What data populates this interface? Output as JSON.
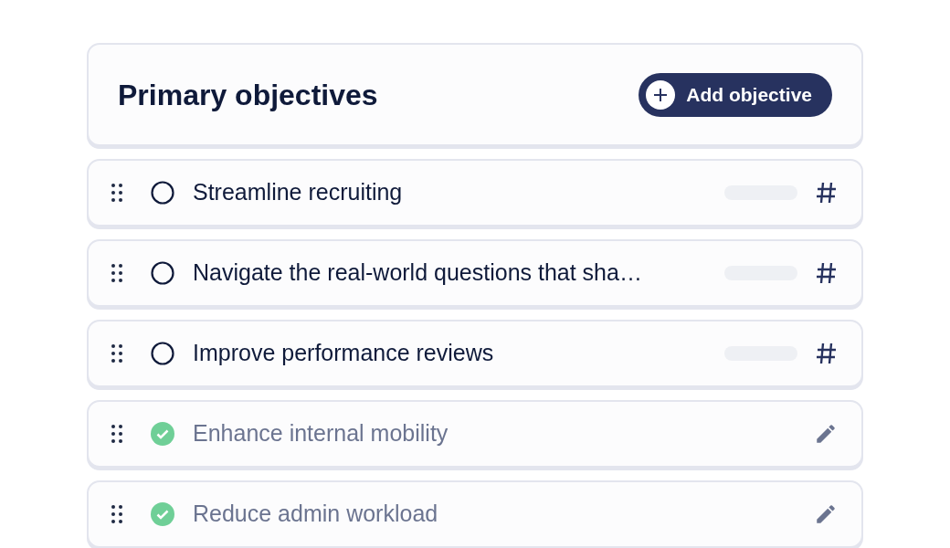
{
  "header": {
    "title": "Primary objectives",
    "button": "Add objective"
  },
  "objectives": [
    {
      "title": "Streamline recruiting",
      "done": false,
      "level": 0
    },
    {
      "title": "Navigate the real-world questions that sha…",
      "done": false,
      "level": 0
    },
    {
      "title": "Improve performance reviews",
      "done": false,
      "level": 0
    },
    {
      "title": "Enhance internal mobility",
      "done": true
    },
    {
      "title": "Reduce admin workload",
      "done": true
    }
  ]
}
